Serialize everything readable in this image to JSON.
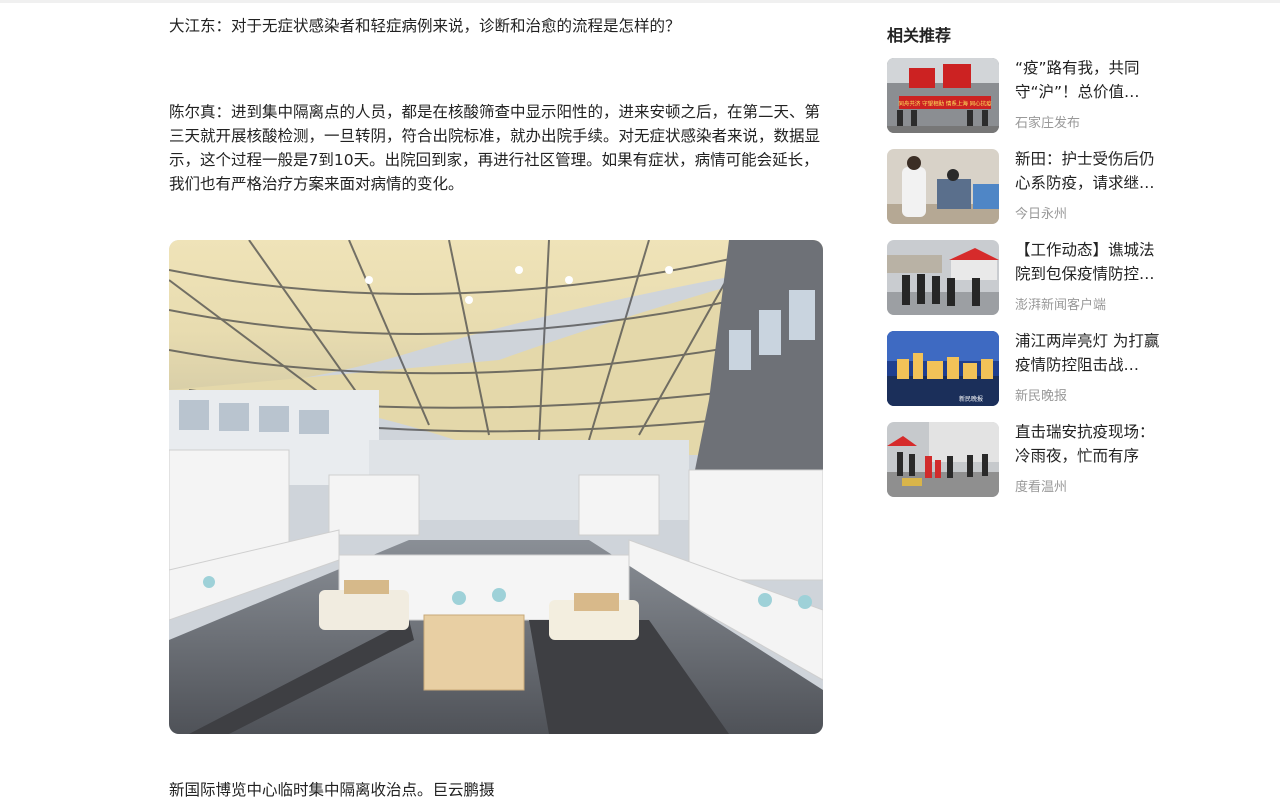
{
  "article": {
    "question": "大江东：对于无症状感染者和轻症病例来说，诊断和治愈的流程是怎样的？",
    "answer": "陈尔真：进到集中隔离点的人员，都是在核酸筛查中显示阳性的，进来安顿之后，在第二天、第三天就开展核酸检测，一旦转阴，符合出院标准，就办出院手续。对无症状感染者来说，数据显示，这个过程一般是7到10天。出院回到家，再进行社区管理。如果有症状，病情可能会延长，我们也有严格治疗方案来面对病情的变化。",
    "caption": "新国际博览中心临时集中隔离收治点。巨云鹏摄"
  },
  "sidebar": {
    "title": "相关推荐",
    "items": [
      {
        "title": "“疫”路有我，共同守“沪”！总价值…",
        "source": "石家庄发布",
        "banner_text": "同舟共济 守望相助 情系上海 同心抗疫"
      },
      {
        "title": "新田：护士受伤后仍心系防疫，请求继…",
        "source": "今日永州"
      },
      {
        "title": "【工作动态】谯城法院到包保疫情防控…",
        "source": "澎湃新闻客户端"
      },
      {
        "title": "浦江两岸亮灯 为打赢疫情防控阻击战…",
        "source": "新民晚报",
        "watermark": "新民晚报"
      },
      {
        "title": "直击瑞安抗疫现场：冷雨夜，忙而有序",
        "source": "度看温州"
      }
    ]
  },
  "colors": {
    "text": "#222222",
    "muted": "#999999"
  }
}
